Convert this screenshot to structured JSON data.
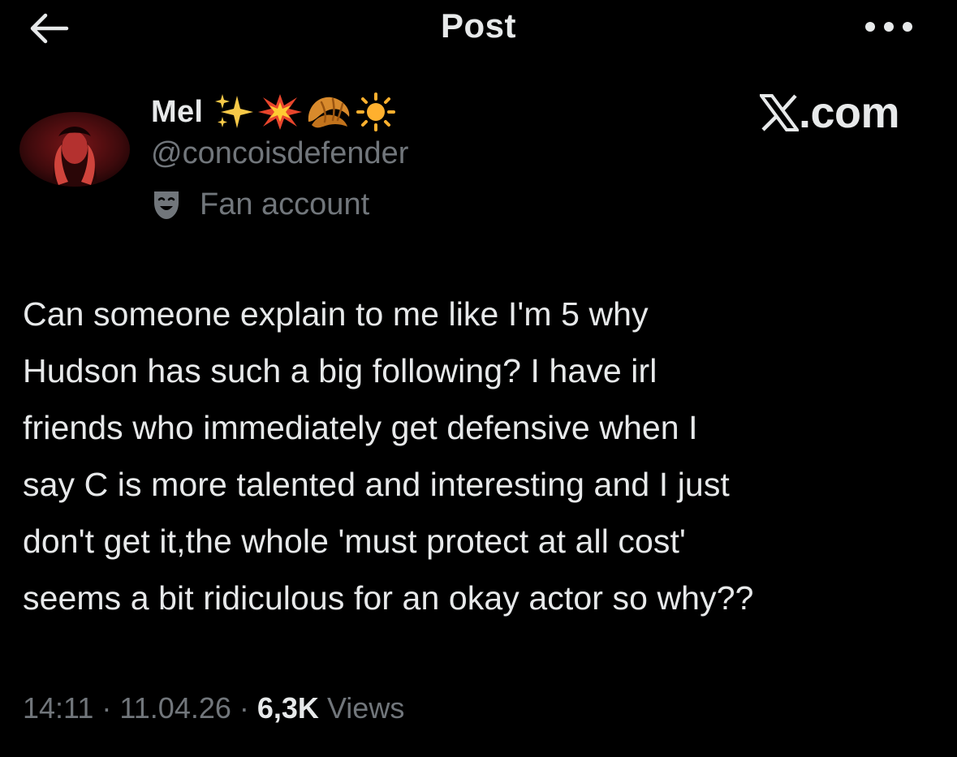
{
  "header": {
    "title": "Post",
    "back_icon": "arrow-left-icon",
    "more_icon": "more-horizontal-icon"
  },
  "post": {
    "author": {
      "display_name": "Mel",
      "name_emoji": [
        "sparkles-icon",
        "collision-icon",
        "croissant-icon",
        "sun-icon"
      ],
      "handle": "@concoisdefender",
      "affiliation_icon": "theater-mask-icon",
      "affiliation": "Fan account"
    },
    "watermark": {
      "logo": "x-logo-icon",
      "text": ".com"
    },
    "body_lines": [
      "Can someone explain to me like I'm 5 why",
      "Hudson has such a big following? I have irl",
      "friends who immediately get defensive when I",
      "say C is more talented and interesting and I just",
      "don't get it,the whole 'must protect at all cost'",
      "seems a bit ridiculous for an okay actor so why??"
    ],
    "meta": {
      "time": "14:11",
      "separator": "·",
      "date": "11.04.26",
      "views_count": "6,3K",
      "views_label": "Views"
    }
  },
  "colors": {
    "background": "#000000",
    "primary_text": "#e7e9ea",
    "secondary_text": "#71767b"
  }
}
